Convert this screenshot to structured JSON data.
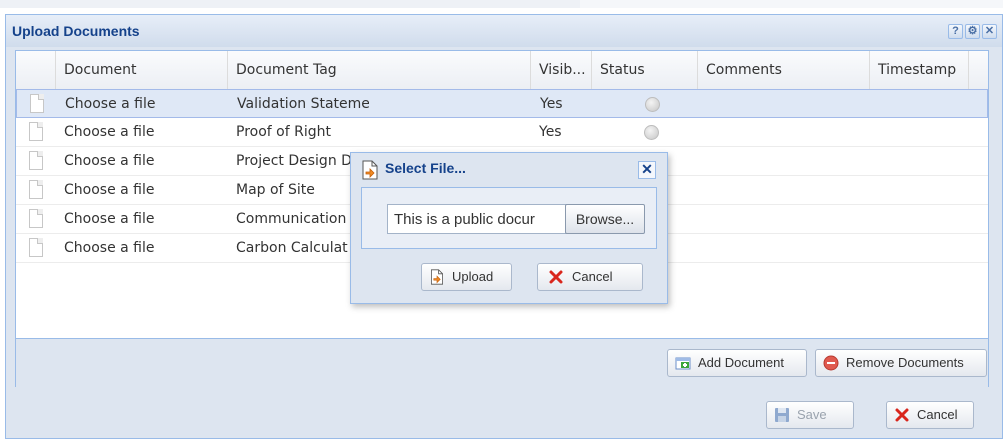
{
  "window": {
    "title": "Upload Documents",
    "tools": {
      "help": "?",
      "gear": "⚙",
      "close": "✕"
    }
  },
  "grid": {
    "columns": [
      "Document",
      "Document Tag",
      "Visib...",
      "Status",
      "Comments",
      "Timestamp"
    ],
    "rows": [
      {
        "document": "Choose a file",
        "tag": "Validation Statement",
        "visible": "Yes",
        "status": "pending",
        "selected": true
      },
      {
        "document": "Choose a file",
        "tag": "Proof of Right",
        "visible": "Yes",
        "status": "pending",
        "selected": false
      },
      {
        "document": "Choose a file",
        "tag": "Project Design D",
        "visible": "",
        "status": "",
        "selected": false
      },
      {
        "document": "Choose a file",
        "tag": "Map of Site",
        "visible": "",
        "status": "",
        "selected": false
      },
      {
        "document": "Choose a file",
        "tag": "Communication",
        "visible": "",
        "status": "",
        "selected": false
      },
      {
        "document": "Choose a file",
        "tag": "Carbon Calculat",
        "visible": "",
        "status": "",
        "selected": false
      }
    ]
  },
  "panel_buttons": {
    "add": "Add Document",
    "remove": "Remove Documents"
  },
  "window_buttons": {
    "save": "Save",
    "cancel": "Cancel"
  },
  "dialog": {
    "title": "Select File...",
    "close": "✕",
    "file_value": "This is a public docur",
    "browse": "Browse...",
    "upload": "Upload",
    "cancel": "Cancel"
  },
  "colors": {
    "title_blue": "#15428b",
    "border_blue": "#99bbe8",
    "panel_bg": "#dde5f0",
    "selected_row": "#dfe8f6",
    "cancel_red": "#d9261c"
  }
}
